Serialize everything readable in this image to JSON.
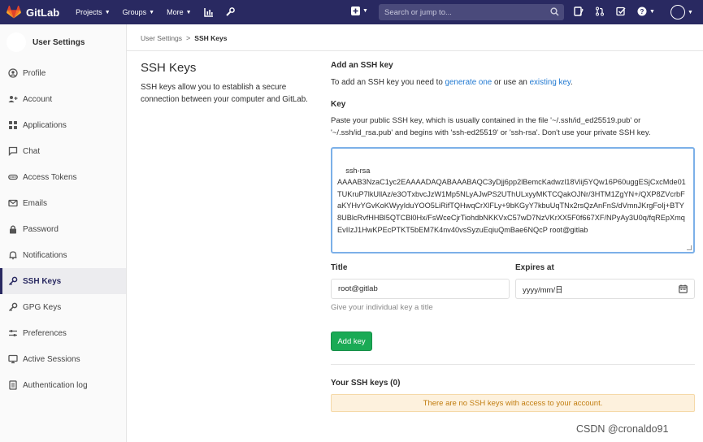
{
  "navbar": {
    "app_name": "GitLab",
    "menu": [
      {
        "label": "Projects"
      },
      {
        "label": "Groups"
      },
      {
        "label": "More"
      }
    ],
    "search_placeholder": "Search or jump to...",
    "colors": {
      "bg": "#292961",
      "logo_orange": "#e24329"
    }
  },
  "sidebar": {
    "title": "User Settings",
    "items": [
      {
        "label": "Profile",
        "icon": "profile-icon"
      },
      {
        "label": "Account",
        "icon": "account-icon"
      },
      {
        "label": "Applications",
        "icon": "applications-icon"
      },
      {
        "label": "Chat",
        "icon": "chat-icon"
      },
      {
        "label": "Access Tokens",
        "icon": "access-tokens-icon"
      },
      {
        "label": "Emails",
        "icon": "emails-icon"
      },
      {
        "label": "Password",
        "icon": "password-icon"
      },
      {
        "label": "Notifications",
        "icon": "notifications-icon"
      },
      {
        "label": "SSH Keys",
        "icon": "ssh-key-icon",
        "active": true
      },
      {
        "label": "GPG Keys",
        "icon": "gpg-key-icon"
      },
      {
        "label": "Preferences",
        "icon": "preferences-icon"
      },
      {
        "label": "Active Sessions",
        "icon": "active-sessions-icon"
      },
      {
        "label": "Authentication log",
        "icon": "authentication-log-icon"
      }
    ]
  },
  "breadcrumb": {
    "parent": "User Settings",
    "separator": ">",
    "current": "SSH Keys"
  },
  "page": {
    "title": "SSH Keys",
    "description": "SSH keys allow you to establish a secure connection between your computer and GitLab."
  },
  "form": {
    "add_heading": "Add an SSH key",
    "add_text_prefix": "To add an SSH key you need to ",
    "generate_link": "generate one",
    "add_text_middle": " or use an ",
    "existing_link": "existing key",
    "add_text_suffix": ".",
    "key_label": "Key",
    "key_help": "Paste your public SSH key, which is usually contained in the file '~/.ssh/id_ed25519.pub' or '~/.ssh/id_rsa.pub' and begins with 'ssh-ed25519' or 'ssh-rsa'. Don't use your private SSH key.",
    "key_value": "ssh-rsa\nAAAAB3NzaC1yc2EAAAADAQABAAABAQC3yDjj6pp2lBemcKadwzl18Viij5YQw16P60uggESjCxcMde01TUKruP7lkUllAz/e3OTxbvcJzW1Mp5NLyAJwPS2UThULxyyMKTCQakOJNr/3HTM1ZgYN+/QXP8ZVcrbFaKYHvYGvKoKWyyIduYOO5LiRifTQHwqCrXlFLy+9bKGyY7kbuUqTNx2rsQzAnFnS/dVmnJKrgFoIj+BTY8UBlcRvfHHBl5QTCBl0Hx/FsWceCjrTiohdbNKKVxC57wD7NzVKrXX5F0f667XF/NPyAy3U0q/fqREpXmqEvIIzJ1HwKPEcPTKT5bEM7K4nv40vsSyzuEqiuQmBae6NQcP root@gitlab",
    "title_label": "Title",
    "title_value": "root@gitlab",
    "expires_label": "Expires at",
    "expires_value": "yyyy/mm/日",
    "title_help": "Give your individual key a title",
    "add_button": "Add key",
    "your_keys_heading": "Your SSH keys (0)",
    "empty_notice": "There are no SSH keys with access to your account."
  },
  "watermark": "CSDN @cronaldo91"
}
